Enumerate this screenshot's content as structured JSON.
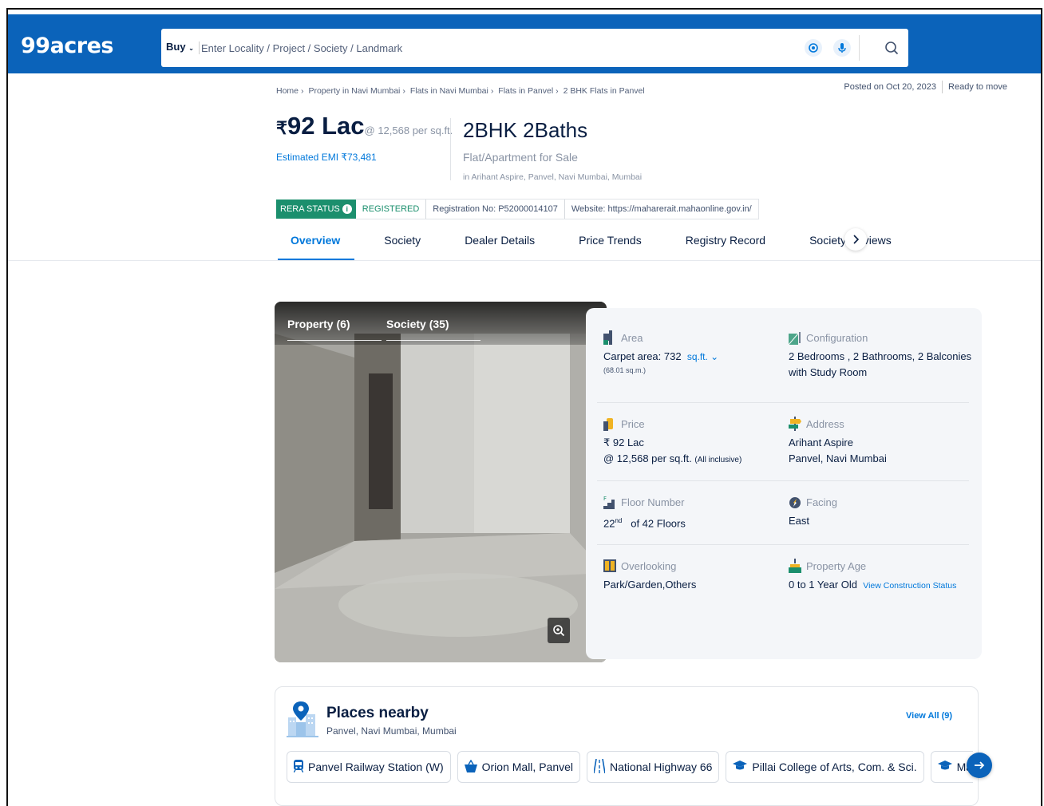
{
  "header": {
    "logo": "99acres",
    "search_type": "Buy",
    "search_placeholder": "Enter Locality / Project / Society / Landmark"
  },
  "breadcrumb": [
    "Home",
    "Property in Navi Mumbai",
    "Flats in Navi Mumbai",
    "Flats in Panvel",
    "2 BHK Flats in Panvel"
  ],
  "meta": {
    "posted": "Posted on Oct 20, 2023",
    "status": "Ready to move"
  },
  "price": {
    "symbol": "₹",
    "amount": "92 Lac",
    "per_sqft": "@ 12,568 per sq.ft.",
    "emi": "Estimated EMI ₹73,481"
  },
  "config": {
    "title": "2BHK 2Baths",
    "subtitle": "Flat/Apartment for Sale",
    "location": "in Arihant Aspire, Panvel, Navi Mumbai, Mumbai"
  },
  "rera": {
    "badge": "RERA STATUS",
    "registered": "REGISTERED",
    "reg_no": "Registration No: P52000014107",
    "website": "Website: https://maharerait.mahaonline.gov.in/"
  },
  "tabs": [
    "Overview",
    "Society",
    "Dealer Details",
    "Price Trends",
    "Registry Record",
    "Society Reviews"
  ],
  "gallery": {
    "tab_property": "Property (6)",
    "tab_society": "Society (35)"
  },
  "details": {
    "area": {
      "label": "Area",
      "value": "Carpet area: 732",
      "unit": "sq.ft.",
      "sub": "(68.01 sq.m.)"
    },
    "configuration": {
      "label": "Configuration",
      "line1": "2 Bedrooms , 2 Bathrooms, 2 Balconies",
      "line2": "with Study Room"
    },
    "price": {
      "label": "Price",
      "line1": "₹ 92 Lac",
      "line2": "@ 12,568 per sq.ft.",
      "line2_note": "(All inclusive)"
    },
    "address": {
      "label": "Address",
      "line1": "Arihant Aspire",
      "line2": "Panvel, Navi Mumbai"
    },
    "floor": {
      "label": "Floor Number",
      "floor": "22",
      "suffix": "nd",
      "of": "of 42 Floors"
    },
    "facing": {
      "label": "Facing",
      "value": "East"
    },
    "overlooking": {
      "label": "Overlooking",
      "value": "Park/Garden,Others"
    },
    "age": {
      "label": "Property Age",
      "value": "0 to 1 Year Old",
      "link": "View Construction Status"
    }
  },
  "places": {
    "title": "Places nearby",
    "subtitle": "Panvel, Navi Mumbai, Mumbai",
    "view_all": "View All (9)",
    "chips": [
      {
        "icon": "train-icon",
        "label": "Panvel Railway Station (W)"
      },
      {
        "icon": "shopping-bag-icon",
        "label": "Orion Mall, Panvel"
      },
      {
        "icon": "highway-icon",
        "label": "National Highway 66"
      },
      {
        "icon": "graduation-cap-icon",
        "label": "Pillai College of Arts, Com. & Sci."
      },
      {
        "icon": "graduation-cap-icon",
        "label": "Mahatma I"
      }
    ]
  },
  "colors": {
    "brand": "#0b63ba",
    "accent": "#0078db",
    "rera_green": "#1b8f6d"
  }
}
